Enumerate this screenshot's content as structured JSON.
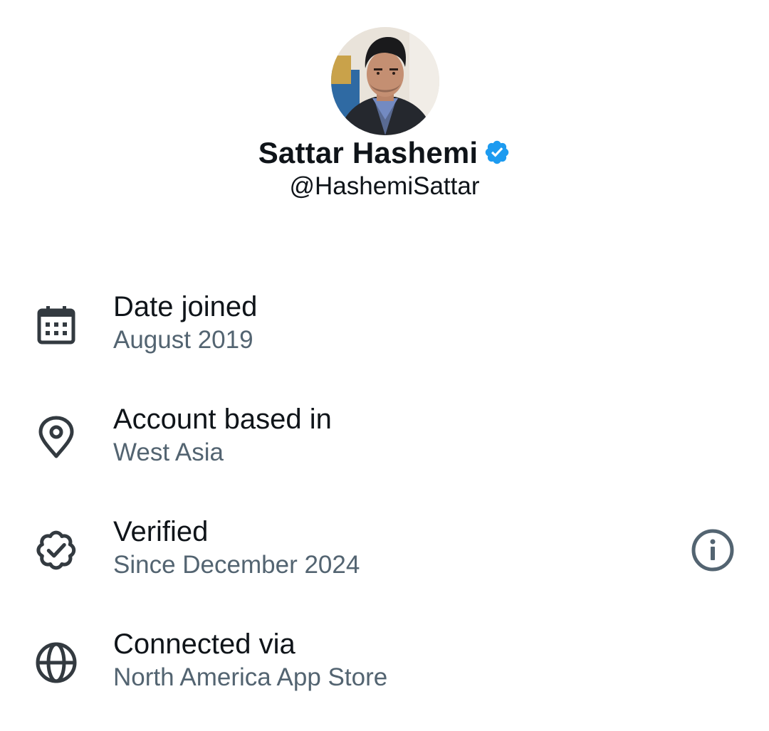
{
  "profile": {
    "display_name": "Sattar Hashemi",
    "handle": "@HashemiSattar",
    "verified": true,
    "badge_color": "#1d9bf0",
    "avatar_icon": "profile-photo"
  },
  "about": {
    "rows": [
      {
        "icon": "calendar-icon",
        "title": "Date joined",
        "value": "August 2019"
      },
      {
        "icon": "location-pin-icon",
        "title": "Account based in",
        "value": "West Asia"
      },
      {
        "icon": "verified-badge-icon",
        "title": "Verified",
        "value": "Since December 2024",
        "has_info": true,
        "info_icon": "info-icon"
      },
      {
        "icon": "globe-icon",
        "title": "Connected via",
        "value": "North America App Store"
      }
    ]
  },
  "colors": {
    "primary_text": "#0f1419",
    "secondary_text": "#536471",
    "icon_stroke": "#333a40",
    "info_icon_stroke": "#536471",
    "accent": "#1d9bf0"
  }
}
